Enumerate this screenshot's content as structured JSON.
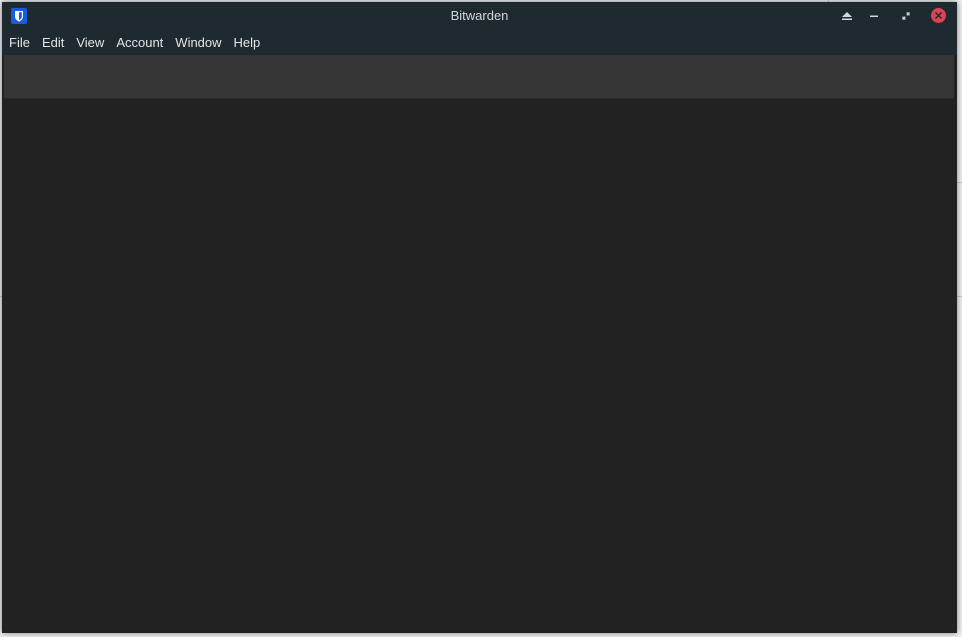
{
  "window": {
    "title": "Bitwarden"
  },
  "menubar": {
    "items": [
      "File",
      "Edit",
      "View",
      "Account",
      "Window",
      "Help"
    ]
  },
  "titlebar_buttons": {
    "keep_above": "keep-above-icon",
    "minimize": "minimize-icon",
    "maximize": "restore-icon",
    "close": "close-icon"
  },
  "colors": {
    "titlebar": "#1f2a30",
    "content": "#222222",
    "toolbar": "#363636",
    "close": "#da4453",
    "brand": "#175ddc"
  }
}
